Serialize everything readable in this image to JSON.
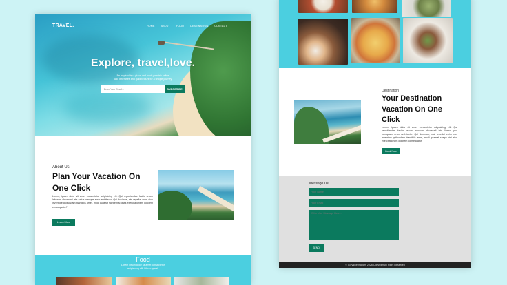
{
  "colors": {
    "background": "#cdf3f5",
    "accent": "#0b7a5e",
    "food_band": "#4bcfe0",
    "contact_bg": "#e0e0e0",
    "footer_bg": "#222222"
  },
  "nav": {
    "logo": "TRAVEL.",
    "links": [
      "HOME",
      "ABOUT",
      "FOOD",
      "DESTINATION",
      "CONTACT"
    ]
  },
  "hero": {
    "title": "Explore, travel,love.",
    "subtitle_line1": "Be inspired by a place and book your trip online",
    "subtitle_line2": "Add itineraries and guided tours for a unique journey",
    "email_placeholder": "Enter Your Email...",
    "subscribe_label": "SUBSCRIBE"
  },
  "about": {
    "label": "About Us",
    "title": "Plan Your Vacation On One Click",
    "text": "Lorem, ipsum dolor sit amet consectetur adipisicing elit. Qui repudiandae facilis rerum laborum obcaecati iste natus cumque error architecto. Qui ducimus, nisi repellat enim eius inventore quibusdam blanditiis amet, modi quaerat saepe nisi quas exercitationem dolorem consequatur?",
    "button": "Learn More"
  },
  "food": {
    "title": "Food",
    "subtitle_line1": "Lorem ipsum dolor sit amet consectetur",
    "subtitle_line2": "adipisicing elit. Libero quasi."
  },
  "destination": {
    "label": "Destination",
    "title": "Your Destination Vacation On One Click",
    "text": "Lorem, ipsum dolor sit amet consectetur adipisicing elit. Qui repudiandae facilis rerum laborum obcaecati iste libero ipsa numquam error architecto. Qui ducimus, nisi repellat enim eos inventore quibusdam blanditiis amet, modi quaerat saepe nisi eius exercitationem dolorem consequatur.",
    "button": "Book Now"
  },
  "contact": {
    "label": "Message Us",
    "name_placeholder": "Your Name",
    "email_placeholder": "Your Email",
    "message_placeholder": "Write Your Message Here...",
    "send_label": "SEND"
  },
  "footer": {
    "text": "© Coryswebnanam 2026 Copyright All Right Reserved"
  }
}
